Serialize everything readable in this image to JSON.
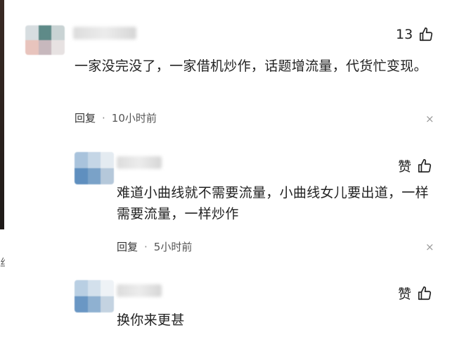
{
  "comments": [
    {
      "likes": "13",
      "text": "一家没完没了，一家借机炒作，话题增流量，代货忙变现。",
      "reply_label": "回复",
      "dot": "·",
      "time": "10小时前",
      "close": "×"
    },
    {
      "likes": "赞",
      "text": "难道小曲线就不需要流量，小曲线女儿要出道，一样需要流量，一样炒作",
      "reply_label": "回复",
      "dot": "·",
      "time": "5小时前",
      "close": "×"
    },
    {
      "likes": "赞",
      "text": "换你来更甚"
    }
  ],
  "edge_mark": "丝",
  "colors": {
    "text": "#222222",
    "meta": "#555555",
    "close": "#9a9a9a"
  },
  "icons": {
    "like": "thumbs-up-icon",
    "close": "close-icon"
  }
}
